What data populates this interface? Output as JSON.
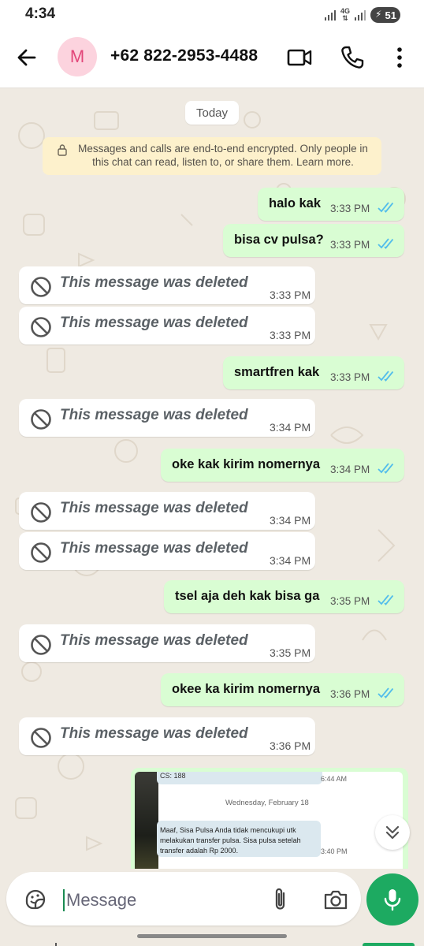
{
  "status_bar": {
    "time": "4:34",
    "network": "4G",
    "battery": "51"
  },
  "header": {
    "avatar_initial": "M",
    "contact_name": "+62 822-2953-4488"
  },
  "chat": {
    "date_chip": "Today",
    "encryption_notice": "Messages and calls are end-to-end encrypted. Only people in this chat can read, listen to, or share them. Learn more.",
    "messages": [
      {
        "dir": "out",
        "text": "halo kak",
        "time": "3:33 PM"
      },
      {
        "dir": "out",
        "text": "bisa cv pulsa?",
        "time": "3:33 PM"
      },
      {
        "dir": "in",
        "text": "This message was deleted",
        "time": "3:33 PM"
      },
      {
        "dir": "in",
        "text": "This message was deleted",
        "time": "3:33 PM"
      },
      {
        "dir": "out",
        "text": "smartfren kak",
        "time": "3:33 PM"
      },
      {
        "dir": "in",
        "text": "This message was deleted",
        "time": "3:34 PM"
      },
      {
        "dir": "out",
        "text": "oke kak kirim nomernya",
        "time": "3:34 PM"
      },
      {
        "dir": "in",
        "text": "This message was deleted",
        "time": "3:34 PM"
      },
      {
        "dir": "in",
        "text": "This message was deleted",
        "time": "3:34 PM"
      },
      {
        "dir": "out",
        "text": "tsel aja deh kak bisa ga",
        "time": "3:35 PM"
      },
      {
        "dir": "in",
        "text": "This message was deleted",
        "time": "3:35 PM"
      },
      {
        "dir": "out",
        "text": "okee ka kirim nomernya",
        "time": "3:36 PM"
      },
      {
        "dir": "in",
        "text": "This message was deleted",
        "time": "3:36 PM"
      }
    ],
    "image_message": {
      "chip1_text": "CS: 188",
      "chip1_time": "6:44 AM",
      "date": "Wednesday, February 18",
      "chip2_text": "Maaf, Sisa Pulsa Anda tidak mencukupi utk melakukan transfer pulsa. Sisa pulsa setelah transfer adalah Rp 2000.",
      "chip2_time": "3:40 PM"
    }
  },
  "input": {
    "placeholder": "Message"
  },
  "colors": {
    "outgoing_bubble": "#d9fdd3",
    "incoming_bubble": "#ffffff",
    "chat_background": "#efeae2",
    "accent_green": "#1daa61",
    "read_ticks": "#53bdeb"
  },
  "icons": [
    "back-arrow-icon",
    "video-call-icon",
    "phone-icon",
    "more-vert-icon",
    "lock-icon",
    "double-check-icon",
    "ban-icon",
    "chevron-double-down-icon",
    "sticker-icon",
    "attach-icon",
    "camera-icon",
    "mic-icon"
  ]
}
